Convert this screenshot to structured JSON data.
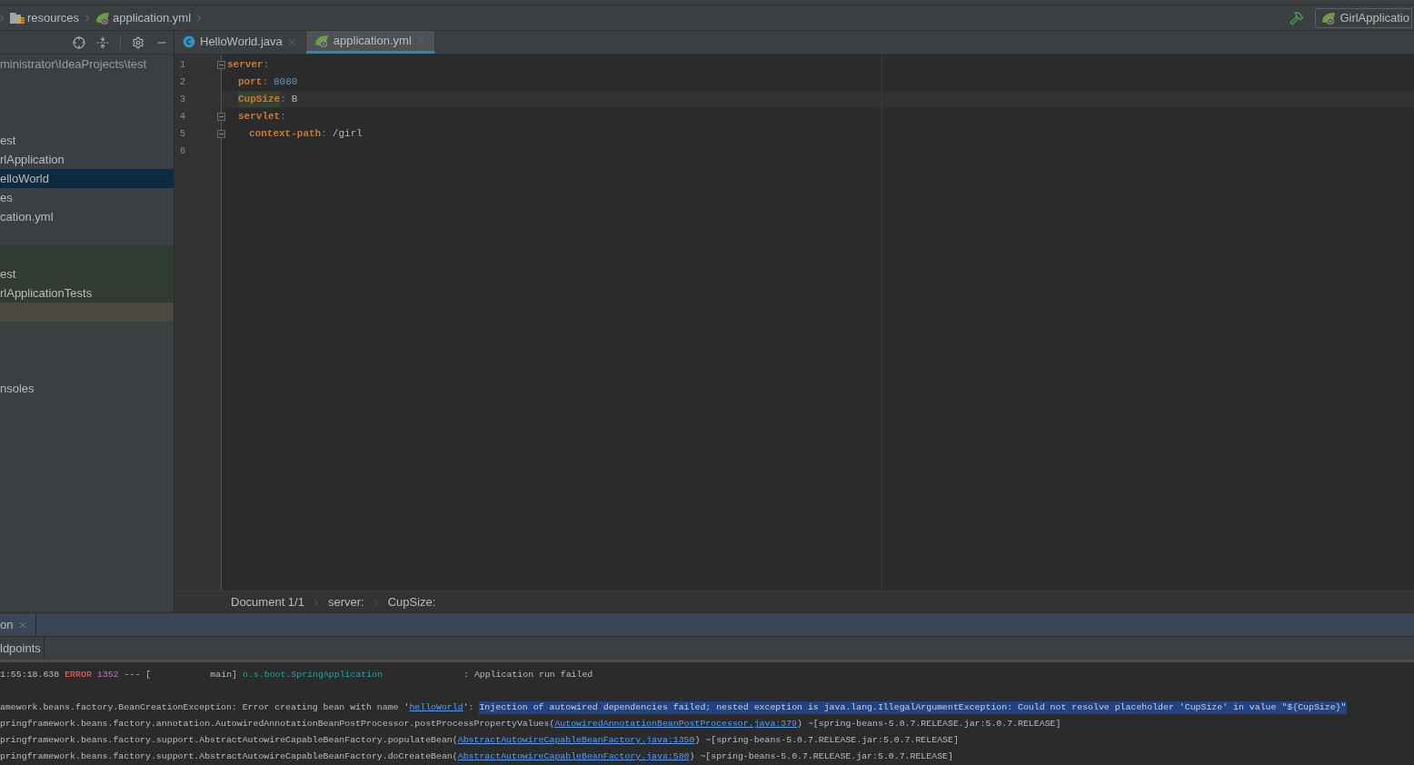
{
  "breadcrumbs": [
    {
      "label": "resources",
      "kind": "folder"
    },
    {
      "label": "application.yml",
      "kind": "spring"
    }
  ],
  "run_config": {
    "label": "GirlApplicatio"
  },
  "project_tree": {
    "rows": [
      {
        "kind": "plain",
        "label": "ministrator\\IdeaProjects\\test",
        "dim": true,
        "selected": false
      },
      {
        "kind": "plain",
        "selected": false
      },
      {
        "kind": "plain",
        "selected": false
      },
      {
        "kind": "plain",
        "selected": false
      },
      {
        "kind": "plain",
        "label": "est",
        "selected": false
      },
      {
        "kind": "plain",
        "label": "rlApplication",
        "selected": false
      },
      {
        "kind": "plain",
        "label": "elloWorld",
        "selected": true
      },
      {
        "kind": "plain",
        "label": "es",
        "selected": false
      },
      {
        "kind": "plain",
        "label": "cation.yml",
        "selected": false
      },
      {
        "kind": "plain",
        "selected": false
      },
      {
        "kind": "test",
        "selected": false
      },
      {
        "kind": "test",
        "label": "est",
        "selected": false
      },
      {
        "kind": "test",
        "label": "rlApplicationTests",
        "selected": false
      },
      {
        "kind": "ignored",
        "selected": false
      },
      {
        "kind": "plain",
        "selected": false
      },
      {
        "kind": "plain",
        "selected": false
      },
      {
        "kind": "plain",
        "selected": false
      },
      {
        "kind": "plain",
        "label": "nsoles",
        "selected": false
      }
    ]
  },
  "editor_tabs": [
    {
      "label": "HelloWorld.java",
      "kind": "class",
      "selected": false
    },
    {
      "label": "application.yml",
      "kind": "spring",
      "selected": true
    }
  ],
  "editor": {
    "lines": [
      {
        "number": "1",
        "key": "server",
        "sep": ":",
        "fold": true,
        "children": [
          {
            "number": "2",
            "key": "port",
            "sep": ":",
            "value": "8080",
            "kind": "number"
          },
          {
            "number": "3",
            "key": "CupSize",
            "sep": ":",
            "value": "B",
            "kind": "string",
            "current": true,
            "key_highlight": true
          },
          {
            "number": "4",
            "key": "servlet",
            "sep": ":",
            "fold": true,
            "children": [
              {
                "number": "5",
                "key": "context-path",
                "sep": ":",
                "value": "/girl",
                "kind": "string",
                "fold": true
              }
            ]
          }
        ]
      },
      {
        "number": "6"
      }
    ]
  },
  "editor_breadcrumbs": [
    "Document 1/1",
    "server:",
    "CupSize:"
  ],
  "run_panel": {
    "tab": {
      "label": "on"
    },
    "subtab": {
      "label": "ldpoints"
    },
    "console": [
      {
        "kind": "log",
        "segments": [
          {
            "kind": "text",
            "text": "1:55:18.638"
          },
          {
            "kind": "error",
            "text": "ERROR"
          },
          {
            "kind": "pid",
            "text": "1352"
          },
          {
            "kind": "text",
            "text": "--- [           main]"
          },
          {
            "kind": "logger",
            "text": "o.s.boot.SpringApplication"
          },
          {
            "kind": "text",
            "text": "              : Application run failed"
          }
        ]
      },
      {
        "kind": "blank"
      },
      {
        "kind": "log",
        "segments": [
          {
            "kind": "text",
            "text": "amework.beans.factory.BeanCreationException: Error creating bean with name '"
          },
          {
            "kind": "link",
            "text": "helloWorld"
          },
          {
            "kind": "text",
            "text": "': "
          },
          {
            "kind": "selection",
            "text": "Injection of autowired dependencies failed; nested exception is java.lang.IllegalArgumentException: Could not resolve placeholder 'CupSize' in value \"${CupSize}\""
          }
        ]
      },
      {
        "kind": "log",
        "segments": [
          {
            "kind": "text",
            "text": "pringframework.beans.factory.annotation.AutowiredAnnotationBeanPostProcessor.postProcessPropertyValues("
          },
          {
            "kind": "link",
            "text": "AutowiredAnnotationBeanPostProcessor.java:379"
          },
          {
            "kind": "text",
            "text": ") ~[spring-beans-5.0.7.RELEASE.jar:5.0.7.RELEASE]"
          }
        ]
      },
      {
        "kind": "log",
        "segments": [
          {
            "kind": "text",
            "text": "pringframework.beans.factory.support.AbstractAutowireCapableBeanFactory.populateBean("
          },
          {
            "kind": "link",
            "text": "AbstractAutowireCapableBeanFactory.java:1350"
          },
          {
            "kind": "text",
            "text": ") ~[spring-beans-5.0.7.RELEASE.jar:5.0.7.RELEASE]"
          }
        ]
      },
      {
        "kind": "log",
        "segments": [
          {
            "kind": "text",
            "text": "pringframework.beans.factory.support.AbstractAutowireCapableBeanFactory.doCreateBean("
          },
          {
            "kind": "link",
            "text": "AbstractAutowireCapableBeanFactory.java:580"
          },
          {
            "kind": "text",
            "text": ") ~[spring-beans-5.0.7.RELEASE.jar:5.0.7.RELEASE]"
          }
        ]
      }
    ]
  }
}
